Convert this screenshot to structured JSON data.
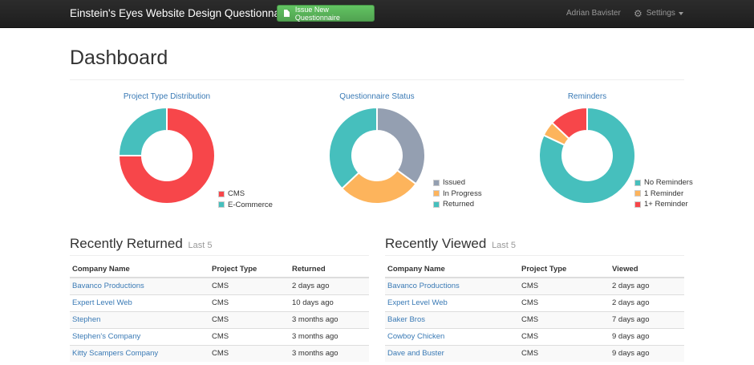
{
  "nav": {
    "brand": "Einstein's Eyes Website Design Questionnaire",
    "issue_button": "Issue New Questionnaire",
    "user": "Adrian Bavister",
    "settings": "Settings"
  },
  "page_title": "Dashboard",
  "charts": {
    "project_type": {
      "title": "Project Type Distribution",
      "legend": [
        {
          "label": "CMS",
          "color": "#f7464a",
          "value": 75
        },
        {
          "label": "E-Commerce",
          "color": "#46bfbd",
          "value": 25
        }
      ]
    },
    "status": {
      "title": "Questionnaire Status",
      "legend": [
        {
          "label": "Issued",
          "color": "#949fb1",
          "value": 35
        },
        {
          "label": "In Progress",
          "color": "#fdb45c",
          "value": 28
        },
        {
          "label": "Returned",
          "color": "#46bfbd",
          "value": 37
        }
      ]
    },
    "reminders": {
      "title": "Reminders",
      "legend": [
        {
          "label": "No Reminders",
          "color": "#46bfbd",
          "value": 82
        },
        {
          "label": "1 Reminder",
          "color": "#fdb45c",
          "value": 5
        },
        {
          "label": "1+ Reminder",
          "color": "#f7464a",
          "value": 13
        }
      ]
    }
  },
  "recently_returned": {
    "title": "Recently Returned",
    "subtitle": "Last 5",
    "columns": [
      "Company Name",
      "Project Type",
      "Returned"
    ],
    "rows": [
      [
        "Bavanco Productions",
        "CMS",
        "2 days ago"
      ],
      [
        "Expert Level Web",
        "CMS",
        "10 days ago"
      ],
      [
        "Stephen",
        "CMS",
        "3 months ago"
      ],
      [
        "Stephen's Company",
        "CMS",
        "3 months ago"
      ],
      [
        "Kitty Scampers Company",
        "CMS",
        "3 months ago"
      ]
    ]
  },
  "recently_viewed": {
    "title": "Recently Viewed",
    "subtitle": "Last 5",
    "columns": [
      "Company Name",
      "Project Type",
      "Viewed"
    ],
    "rows": [
      [
        "Bavanco Productions",
        "CMS",
        "2 days ago"
      ],
      [
        "Expert Level Web",
        "CMS",
        "2 days ago"
      ],
      [
        "Baker Bros",
        "CMS",
        "7 days ago"
      ],
      [
        "Cowboy Chicken",
        "CMS",
        "9 days ago"
      ],
      [
        "Dave and Buster",
        "CMS",
        "9 days ago"
      ]
    ]
  }
}
